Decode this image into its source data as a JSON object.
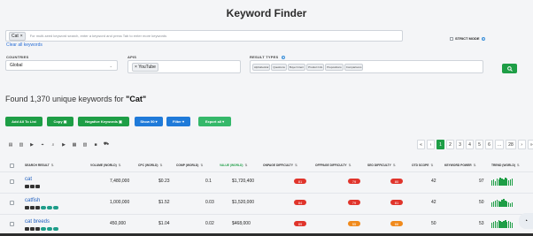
{
  "page_title": "Keyword Finder",
  "search": {
    "tag": "Cat",
    "tag_close": "×",
    "placeholder": "For multi-seed keyword search, enter a keyword and press Tab to enter more keywords",
    "clear_link": "Clear all keywords",
    "strict_mode": "STRICT MODE"
  },
  "filters": {
    "countries_label": "COUNTRIES",
    "country_value": "Global",
    "apis_label": "APIS",
    "api_value": "YouTube",
    "result_types_label": "RESULT TYPES",
    "result_types": [
      "Alphabetical",
      "Questions",
      "Buyer Intent",
      "Product Info",
      "Prepositions",
      "Comparisons"
    ]
  },
  "results": {
    "found_prefix": "Found 1,370 unique keywords for ",
    "keyword": "\"Cat\""
  },
  "actions": {
    "add_all": "Add All To List",
    "copy": "Copy",
    "negative": "Negative Keywords",
    "show": "Show 50",
    "filter": "Filter",
    "export": "Export all"
  },
  "pagination": {
    "first": "«",
    "prev": "‹",
    "pages": [
      "1",
      "2",
      "3",
      "4",
      "5",
      "6",
      "...",
      "28"
    ],
    "next": "›",
    "last": "»"
  },
  "table": {
    "headers": [
      "SEARCH RESULT",
      "VOLUME (WORLD)",
      "CPC (WORLD)",
      "COMP (WORLD)",
      "VALUE (WORLD)",
      "ONPAGE DIFFICULTY",
      "OFFPAGE DIFFICULTY",
      "SEO DIFFICULTY",
      "OTD SCOPE",
      "KEYWORD POWER",
      "TREND (WORLD)"
    ],
    "rows": [
      {
        "keyword": "cat",
        "volume": "7,480,000",
        "cpc": "$0.23",
        "comp": "0.1",
        "value": "$1,720,400",
        "onpage": "81",
        "offpage": "79",
        "seo": "80",
        "otd": "42",
        "power": "97",
        "trend": [
          6,
          7,
          5,
          8,
          7,
          9,
          8,
          7,
          9,
          8,
          6,
          7,
          8
        ]
      },
      {
        "keyword": "catfish",
        "volume": "1,000,000",
        "cpc": "$1.52",
        "comp": "0.03",
        "value": "$1,520,000",
        "onpage": "84",
        "offpage": "79",
        "seo": "81",
        "otd": "42",
        "power": "50",
        "trend": [
          5,
          6,
          7,
          8,
          7,
          6,
          8,
          9,
          7,
          6,
          5,
          4,
          5
        ]
      },
      {
        "keyword": "cat breeds",
        "volume": "450,000",
        "cpc": "$1.04",
        "comp": "0.02",
        "value": "$468,000",
        "onpage": "89",
        "offpage": "55",
        "seo": "66",
        "otd": "50",
        "power": "53",
        "trend": [
          6,
          7,
          8,
          7,
          9,
          8,
          7,
          8,
          9,
          7,
          8,
          7,
          6
        ]
      }
    ]
  },
  "colors": {
    "green": "#1e9e46",
    "blue": "#1f7ad9",
    "red": "#e0342b",
    "orange": "#f08a1c"
  }
}
